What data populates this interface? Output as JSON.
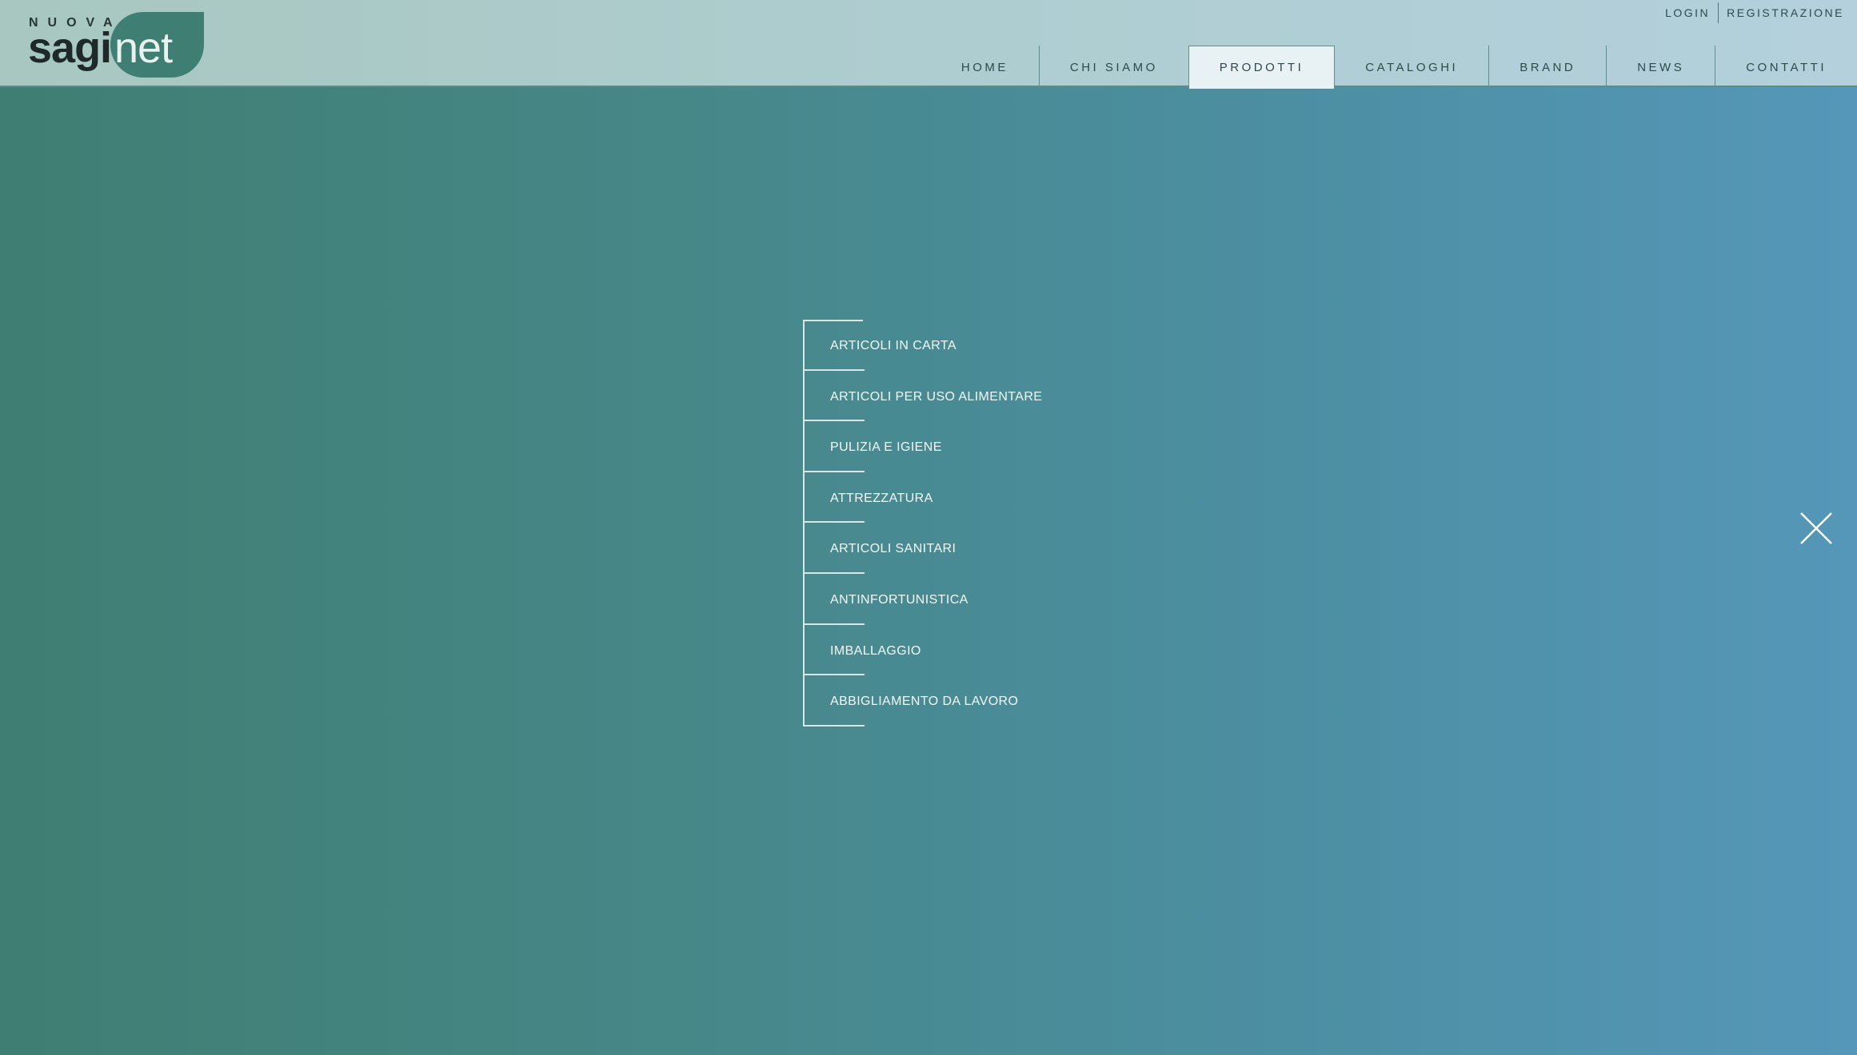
{
  "brand": {
    "logo_prefix": "NUOVA",
    "logo_main": "sagi",
    "logo_accent": "net"
  },
  "top_links": {
    "login": "LOGIN",
    "register": "REGISTRAZIONE"
  },
  "nav": {
    "items": [
      {
        "label": "HOME"
      },
      {
        "label": "CHI SIAMO"
      },
      {
        "label": "PRODOTTI",
        "active": true
      },
      {
        "label": "CATALOGHI"
      },
      {
        "label": "BRAND"
      },
      {
        "label": "NEWS"
      },
      {
        "label": "CONTATTI"
      }
    ]
  },
  "products_menu": {
    "items": [
      {
        "label": "ARTICOLI IN CARTA"
      },
      {
        "label": "ARTICOLI PER USO ALIMENTARE"
      },
      {
        "label": "PULIZIA E IGIENE"
      },
      {
        "label": "ATTREZZATURA"
      },
      {
        "label": "ARTICOLI SANITARI"
      },
      {
        "label": "ANTINFORTUNISTICA"
      },
      {
        "label": "IMBALLAGGIO"
      },
      {
        "label": "ABBIGLIAMENTO DA LAVORO"
      }
    ]
  },
  "icons": {
    "close": "close-icon"
  },
  "colors": {
    "brand_green": "#3f7e72",
    "header_bg": "#aecdd0",
    "overlay_start": "#3f7e72",
    "overlay_end": "#5597b8",
    "menu_text": "#f2f7f7"
  }
}
